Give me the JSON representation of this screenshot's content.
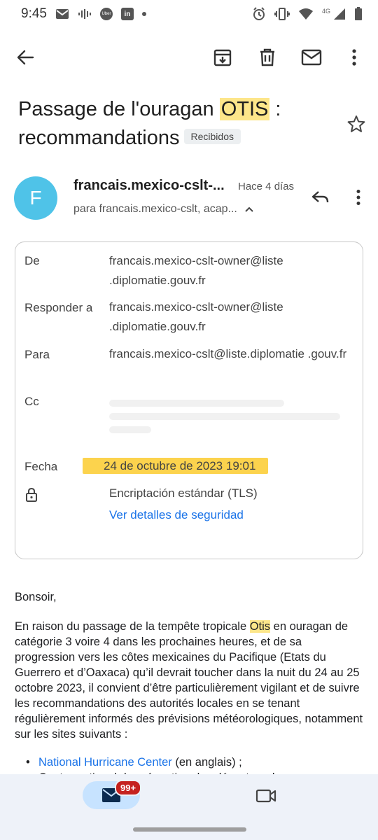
{
  "status_bar": {
    "time": "9:45",
    "network": "4G",
    "left_icons": [
      "gmail-icon",
      "voice-icon",
      "uber-icon",
      "linkedin-icon",
      "dot-icon"
    ],
    "right_icons": [
      "alarm-icon",
      "vibrate-icon",
      "wifi-icon",
      "signal-icon",
      "battery-icon"
    ],
    "uber_label": "Uber",
    "linkedin_label": "in"
  },
  "toolbar": {
    "back": "back-arrow-icon",
    "archive": "archive-icon",
    "delete": "trash-icon",
    "mark_unread": "mail-icon",
    "more": "more-vert-icon"
  },
  "email": {
    "subject_part1": "Passage de l'ouragan ",
    "subject_highlight": "OTIS",
    "subject_part2": " : recommandations",
    "label": "Recibidos",
    "avatar_letter": "F",
    "sender": "francais.mexico-cslt-...",
    "time": "Hace 4 días",
    "recipients": "para francais.mexico-cslt, acap..."
  },
  "details": {
    "from_label": "De",
    "from_value": "francais.mexico-cslt-owner@liste .diplomatie.gouv.fr",
    "reply_to_label": "Responder a",
    "reply_to_value": "francais.mexico-cslt-owner@liste .diplomatie.gouv.fr",
    "to_label": "Para",
    "to_value": "francais.mexico-cslt@liste.diplomatie .gouv.fr",
    "cc_label": "Cc",
    "date_label": "Fecha",
    "date_value": "24 de octubre de 2023 19:01",
    "encryption": "Encriptación estándar (TLS)",
    "security_link": "Ver detalles de seguridad"
  },
  "body": {
    "greeting": "Bonsoir,",
    "p1_before": "En raison du passage de la tempête tropicale ",
    "p1_highlight": "Otis",
    "p1_after": " en ouragan de catégorie 3 voire 4 dans les prochaines heures, et de sa progression vers les côtes mexicaines du Pacifique (Etats du Guerrero et d’Oaxaca) qu’il devrait toucher dans la nuit du 24 au 25 octobre 2023, il convient d’être particulièrement vigilant et de suivre les recommandations des autorités locales en se tenant régulièrement informés des prévisions météorologiques, notamment sur les sites suivants :",
    "list": [
      {
        "link": "National Hurricane Center",
        "text": " (en anglais) ;"
      },
      {
        "link": "",
        "text": "Centre national de prévention des désastres du"
      }
    ]
  },
  "bottom_nav": {
    "mail_badge": "99+"
  },
  "colors": {
    "accent": "#1a73e8",
    "highlight": "#fde68a",
    "date_highlight": "#fcd34d",
    "avatar": "#4fc3e8",
    "badge": "#c5221f"
  }
}
